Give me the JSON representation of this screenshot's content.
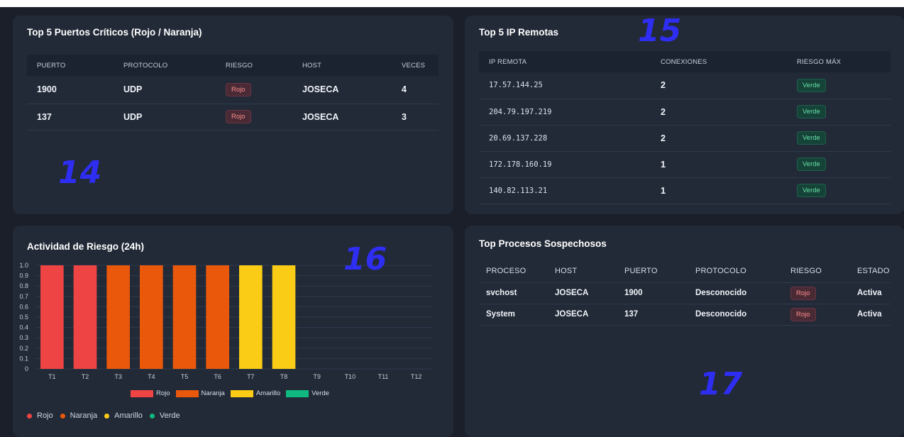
{
  "colors": {
    "rojo": "#ef4444",
    "naranja": "#ea580c",
    "amarillo": "#facc15",
    "verde": "#10b981",
    "annotation": "#2e2df2"
  },
  "puertos": {
    "title": "Top 5 Puertos Críticos (Rojo / Naranja)",
    "headers": [
      "PUERTO",
      "PROTOCOLO",
      "RIESGO",
      "HOST",
      "VECES"
    ],
    "rows": [
      {
        "puerto": "1900",
        "protocolo": "UDP",
        "riesgo": "Rojo",
        "host": "JOSECA",
        "veces": "4"
      },
      {
        "puerto": "137",
        "protocolo": "UDP",
        "riesgo": "Rojo",
        "host": "JOSECA",
        "veces": "3"
      }
    ],
    "annotation": "14"
  },
  "ips": {
    "title": "Top 5 IP Remotas",
    "headers": [
      "IP REMOTA",
      "CONEXIONES",
      "RIESGO MÁX"
    ],
    "rows": [
      {
        "ip": "17.57.144.25",
        "conexiones": "2",
        "riesgo": "Verde"
      },
      {
        "ip": "204.79.197.219",
        "conexiones": "2",
        "riesgo": "Verde"
      },
      {
        "ip": "20.69.137.228",
        "conexiones": "2",
        "riesgo": "Verde"
      },
      {
        "ip": "172.178.160.19",
        "conexiones": "1",
        "riesgo": "Verde"
      },
      {
        "ip": "140.82.113.21",
        "conexiones": "1",
        "riesgo": "Verde"
      }
    ],
    "annotation": "15"
  },
  "actividad": {
    "title": "Actividad de Riesgo (24h)",
    "annotation": "16",
    "dot_legend": [
      "Rojo",
      "Naranja",
      "Amarillo",
      "Verde"
    ]
  },
  "chart_data": {
    "type": "bar",
    "title": "Actividad de Riesgo (24h)",
    "categories": [
      "T1",
      "T2",
      "T3",
      "T4",
      "T5",
      "T6",
      "T7",
      "T8",
      "T9",
      "T10",
      "T11",
      "T12"
    ],
    "series": [
      {
        "name": "Rojo",
        "color": "#ef4444",
        "values": [
          1,
          1,
          0,
          0,
          0,
          0,
          0,
          0,
          0,
          0,
          0,
          0
        ]
      },
      {
        "name": "Naranja",
        "color": "#ea580c",
        "values": [
          0,
          0,
          1,
          1,
          1,
          1,
          0,
          0,
          0,
          0,
          0,
          0
        ]
      },
      {
        "name": "Amarillo",
        "color": "#facc15",
        "values": [
          0,
          0,
          0,
          0,
          0,
          0,
          1,
          1,
          0,
          0,
          0,
          0
        ]
      },
      {
        "name": "Verde",
        "color": "#10b981",
        "values": [
          0,
          0,
          0,
          0,
          0,
          0,
          0,
          0,
          0,
          0,
          0,
          0
        ]
      }
    ],
    "ylim": [
      0,
      1.0
    ],
    "yticks": [
      "0",
      "0.1",
      "0.2",
      "0.3",
      "0.4",
      "0.5",
      "0.6",
      "0.7",
      "0.8",
      "0.9",
      "1.0"
    ],
    "stacked": true,
    "grid": true,
    "legend": "bottom"
  },
  "procesos": {
    "title": "Top Procesos Sospechosos",
    "headers": [
      "PROCESO",
      "HOST",
      "PUERTO",
      "PROTOCOLO",
      "RIESGO",
      "ESTADO"
    ],
    "rows": [
      {
        "proceso": "svchost",
        "host": "JOSECA",
        "puerto": "1900",
        "protocolo": "Desconocido",
        "riesgo": "Rojo",
        "estado": "Activa"
      },
      {
        "proceso": "System",
        "host": "JOSECA",
        "puerto": "137",
        "protocolo": "Desconocido",
        "riesgo": "Rojo",
        "estado": "Activa"
      }
    ],
    "annotation": "17"
  }
}
